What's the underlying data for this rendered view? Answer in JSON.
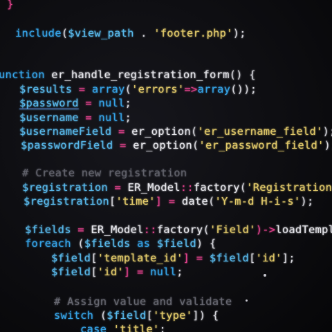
{
  "editor": {
    "lines": [
      [
        {
          "t": "}",
          "c": "op"
        }
      ],
      [
        {
          "t": "include",
          "c": "kw"
        },
        {
          "t": "(",
          "c": "punc"
        },
        {
          "t": "$view_path",
          "c": "var"
        },
        {
          "t": " . ",
          "c": "punc"
        },
        {
          "t": "'footer.php'",
          "c": "str"
        },
        {
          "t": ");",
          "c": "punc"
        }
      ],
      [
        {
          "t": "unction ",
          "c": "kw"
        },
        {
          "t": "er_handle_registration_form",
          "c": "fn"
        },
        {
          "t": "() {",
          "c": "punc"
        }
      ],
      [
        {
          "t": "$results",
          "c": "var"
        },
        {
          "t": " = ",
          "c": "op"
        },
        {
          "t": "array",
          "c": "kw"
        },
        {
          "t": "(",
          "c": "punc"
        },
        {
          "t": "'errors'",
          "c": "str"
        },
        {
          "t": "=>",
          "c": "op"
        },
        {
          "t": "array",
          "c": "kw"
        },
        {
          "t": "());",
          "c": "punc"
        }
      ],
      [
        {
          "t": "$password",
          "c": "var sel"
        },
        {
          "t": " = ",
          "c": "op"
        },
        {
          "t": "null",
          "c": "kw"
        },
        {
          "t": ";",
          "c": "punc"
        }
      ],
      [
        {
          "t": "$username",
          "c": "var"
        },
        {
          "t": " = ",
          "c": "op"
        },
        {
          "t": "null",
          "c": "kw"
        },
        {
          "t": ";",
          "c": "punc"
        }
      ],
      [
        {
          "t": "$usernameField",
          "c": "var"
        },
        {
          "t": " = ",
          "c": "op"
        },
        {
          "t": "er_option",
          "c": "fn"
        },
        {
          "t": "(",
          "c": "punc"
        },
        {
          "t": "'er_username_field'",
          "c": "str"
        },
        {
          "t": ");",
          "c": "punc"
        }
      ],
      [
        {
          "t": "$passwordField",
          "c": "var"
        },
        {
          "t": " = ",
          "c": "op"
        },
        {
          "t": "er_option",
          "c": "fn"
        },
        {
          "t": "(",
          "c": "punc"
        },
        {
          "t": "'er_password_field'",
          "c": "str"
        },
        {
          "t": ");",
          "c": "punc"
        }
      ],
      [
        {
          "t": "# Create new registration",
          "c": "cmt"
        }
      ],
      [
        {
          "t": "$registration",
          "c": "var"
        },
        {
          "t": " = ",
          "c": "op"
        },
        {
          "t": "ER_Model",
          "c": "cls"
        },
        {
          "t": "::",
          "c": "op"
        },
        {
          "t": "factory",
          "c": "fn"
        },
        {
          "t": "(",
          "c": "punc"
        },
        {
          "t": "'Registration'",
          "c": "str"
        },
        {
          "t": ")",
          "c": "punc"
        }
      ],
      [
        {
          "t": "$registration",
          "c": "var"
        },
        {
          "t": "[",
          "c": "punc"
        },
        {
          "t": "'time'",
          "c": "str"
        },
        {
          "t": "] = ",
          "c": "op"
        },
        {
          "t": "date",
          "c": "fn"
        },
        {
          "t": "(",
          "c": "punc"
        },
        {
          "t": "'Y-m-d H-i-s'",
          "c": "str"
        },
        {
          "t": ");",
          "c": "punc"
        }
      ],
      [
        {
          "t": "$fields",
          "c": "var"
        },
        {
          "t": " = ",
          "c": "op"
        },
        {
          "t": "ER_Model",
          "c": "cls"
        },
        {
          "t": "::",
          "c": "op"
        },
        {
          "t": "factory",
          "c": "fn"
        },
        {
          "t": "(",
          "c": "punc"
        },
        {
          "t": "'Field'",
          "c": "str"
        },
        {
          "t": ")->",
          "c": "op"
        },
        {
          "t": "loadTemplat",
          "c": "fn"
        }
      ],
      [
        {
          "t": "foreach",
          "c": "kw"
        },
        {
          "t": " (",
          "c": "punc"
        },
        {
          "t": "$fields",
          "c": "var"
        },
        {
          "t": " as ",
          "c": "kw"
        },
        {
          "t": "$field",
          "c": "var"
        },
        {
          "t": ") {",
          "c": "punc"
        }
      ],
      [
        {
          "t": "$field",
          "c": "var"
        },
        {
          "t": "[",
          "c": "punc"
        },
        {
          "t": "'template_id'",
          "c": "str"
        },
        {
          "t": "] = ",
          "c": "op"
        },
        {
          "t": "$field",
          "c": "var"
        },
        {
          "t": "[",
          "c": "punc"
        },
        {
          "t": "'id'",
          "c": "str"
        },
        {
          "t": "];",
          "c": "punc"
        }
      ],
      [
        {
          "t": "$field",
          "c": "var"
        },
        {
          "t": "[",
          "c": "punc"
        },
        {
          "t": "'id'",
          "c": "str"
        },
        {
          "t": "] = ",
          "c": "op"
        },
        {
          "t": "null",
          "c": "kw"
        },
        {
          "t": ";",
          "c": "punc"
        }
      ],
      [
        {
          "t": "# Assign value and validate",
          "c": "cmt"
        }
      ],
      [
        {
          "t": "switch",
          "c": "kw"
        },
        {
          "t": " (",
          "c": "punc"
        },
        {
          "t": "$field",
          "c": "var"
        },
        {
          "t": "[",
          "c": "punc"
        },
        {
          "t": "'type'",
          "c": "str"
        },
        {
          "t": "]) {",
          "c": "punc"
        }
      ],
      [
        {
          "t": "case ",
          "c": "kw"
        },
        {
          "t": "'title'",
          "c": "str"
        },
        {
          "t": ":",
          "c": "punc"
        }
      ]
    ]
  }
}
